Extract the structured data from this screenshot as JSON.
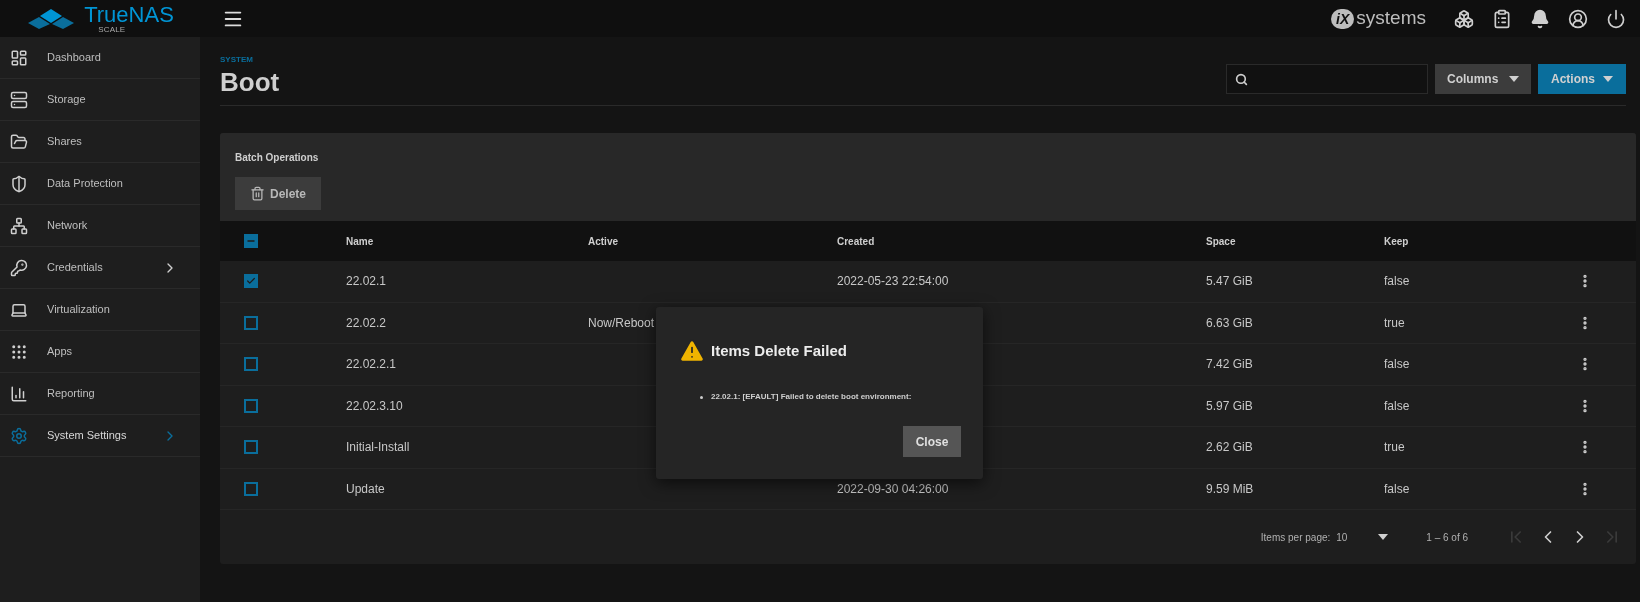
{
  "topbar": {
    "logo": {
      "name": "TrueNAS",
      "edition": "SCALE"
    },
    "vendor": {
      "mark": "iX",
      "name": "systems"
    }
  },
  "sidebar": {
    "items": [
      {
        "label": "Dashboard",
        "selected": false,
        "has_submenu": false
      },
      {
        "label": "Storage",
        "selected": false,
        "has_submenu": false
      },
      {
        "label": "Shares",
        "selected": false,
        "has_submenu": false
      },
      {
        "label": "Data Protection",
        "selected": false,
        "has_submenu": false
      },
      {
        "label": "Network",
        "selected": false,
        "has_submenu": false
      },
      {
        "label": "Credentials",
        "selected": false,
        "has_submenu": true
      },
      {
        "label": "Virtualization",
        "selected": false,
        "has_submenu": false
      },
      {
        "label": "Apps",
        "selected": false,
        "has_submenu": false
      },
      {
        "label": "Reporting",
        "selected": false,
        "has_submenu": false
      },
      {
        "label": "System Settings",
        "selected": true,
        "has_submenu": true
      }
    ]
  },
  "page": {
    "breadcrumb": "SYSTEM",
    "title": "Boot",
    "columns_button": "Columns",
    "actions_button": "Actions"
  },
  "batch": {
    "title": "Batch Operations",
    "delete_button": "Delete"
  },
  "table": {
    "select_all": {
      "indeterminate": true
    },
    "columns": [
      "Name",
      "Active",
      "Created",
      "Space",
      "Keep"
    ],
    "rows": [
      {
        "selected": true,
        "name": "22.02.1",
        "created": "2022-05-23 22:54:00",
        "space": "5.47 GiB",
        "keep": "false"
      },
      {
        "selected": false,
        "name": "22.02.2",
        "active": "Now/Reboot",
        "space": "6.63 GiB",
        "keep": "true"
      },
      {
        "selected": false,
        "name": "22.02.2.1",
        "space": "7.42 GiB",
        "keep": "false"
      },
      {
        "selected": false,
        "name": "22.02.3.10",
        "space": "5.97 GiB",
        "keep": "false"
      },
      {
        "selected": false,
        "name": "Initial-Install",
        "space": "2.62 GiB",
        "keep": "true"
      },
      {
        "selected": false,
        "name": "Update",
        "created": "2022-09-30 04:26:00",
        "space": "9.59 MiB",
        "keep": "false"
      }
    ]
  },
  "paginator": {
    "label": "Items per page:",
    "page_size": "10",
    "range": "1 – 6 of 6",
    "first_disabled": true,
    "previous_disabled": false,
    "next_disabled": false,
    "last_disabled": true
  },
  "dialog": {
    "title": "Items Delete Failed",
    "errors": [
      "22.02.1: [EFAULT] Failed to delete boot environment:"
    ],
    "close_button": "Close"
  }
}
